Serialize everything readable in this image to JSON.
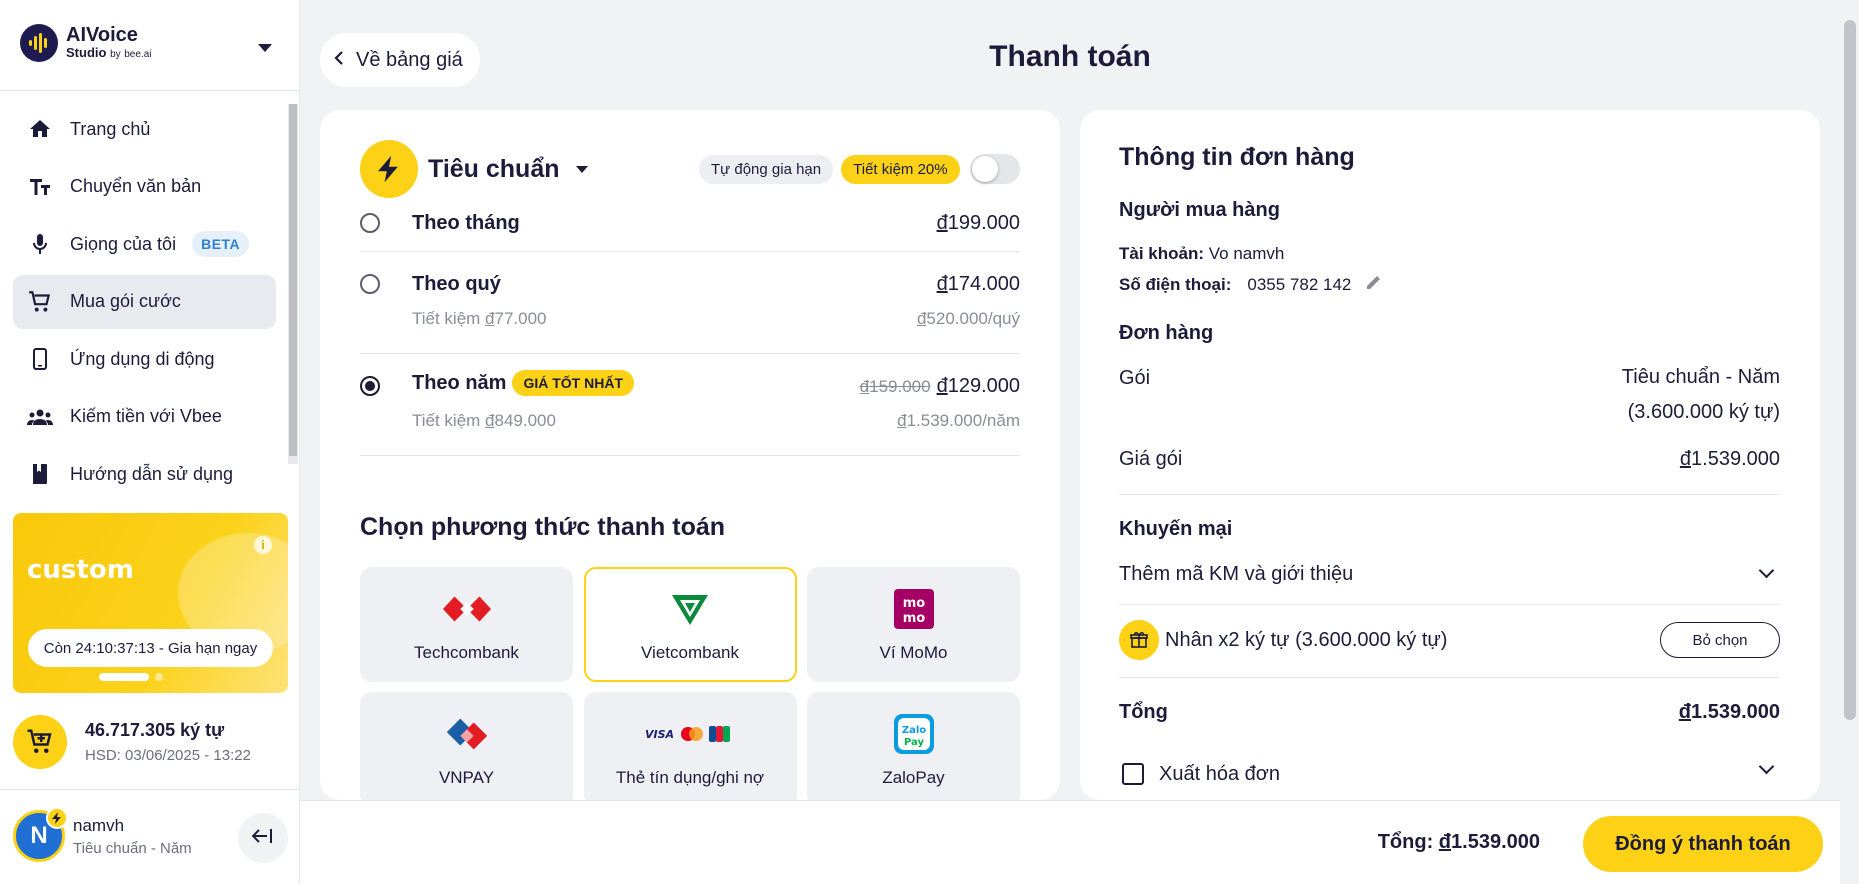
{
  "brand": {
    "name_line1": "AIVoice",
    "name_line2": "Studio",
    "by": "by",
    "partner": "bee.ai"
  },
  "sidebar": {
    "items": [
      {
        "label": "Trang chủ",
        "icon": "home-icon"
      },
      {
        "label": "Chuyển văn bản",
        "icon": "text-size-icon"
      },
      {
        "label": "Giọng của tôi",
        "icon": "microphone-icon",
        "badge": "BETA"
      },
      {
        "label": "Mua gói cước",
        "icon": "cart-icon",
        "active": true
      },
      {
        "label": "Ứng dụng di động",
        "icon": "phone-icon"
      },
      {
        "label": "Kiếm tiền với Vbee",
        "icon": "people-icon"
      },
      {
        "label": "Hướng dẫn sử dụng",
        "icon": "book-icon"
      }
    ],
    "promo": {
      "title": "custom",
      "countdown": "Còn 24:10:37:13 - Gia hạn ngay",
      "info": "i"
    },
    "credits": {
      "amount": "46.717.305 ký tự",
      "expiry": "HSD: 03/06/2025 - 13:22"
    },
    "user": {
      "initial": "N",
      "name": "namvh",
      "plan": "Tiêu chuẩn - Năm"
    }
  },
  "header": {
    "back_label": "Về bảng giá",
    "title": "Thanh toán"
  },
  "plan": {
    "name": "Tiêu chuẩn",
    "auto_renew_label": "Tự động gia hạn",
    "save_badge": "Tiết kiệm 20%",
    "auto_renew_on": false,
    "options": [
      {
        "label": "Theo tháng",
        "currency": "đ",
        "price": "199.000",
        "selected": false
      },
      {
        "label": "Theo quý",
        "currency": "đ",
        "price": "174.000",
        "save_prefix": "Tiết kiệm ",
        "save_amount": "77.000",
        "total_amount": "520.000",
        "total_suffix": "/quý",
        "selected": false
      },
      {
        "label": "Theo năm",
        "badge": "GIÁ TỐT NHẤT",
        "old_price": "159.000",
        "currency": "đ",
        "price": "129.000",
        "save_prefix": "Tiết kiệm ",
        "save_amount": "849.000",
        "total_amount": "1.539.000",
        "total_suffix": "/năm",
        "selected": true
      }
    ]
  },
  "payment": {
    "title": "Chọn phương thức thanh toán",
    "methods": [
      {
        "label": "Techcombank",
        "icon": "techcombank-logo"
      },
      {
        "label": "Vietcombank",
        "icon": "vietcombank-logo",
        "selected": true
      },
      {
        "label": "Ví MoMo",
        "icon": "momo-logo"
      },
      {
        "label": "VNPAY",
        "icon": "vnpay-logo"
      },
      {
        "label": "Thẻ tín dụng/ghi nợ",
        "icon": "card-logos"
      },
      {
        "label": "ZaloPay",
        "icon": "zalopay-logo"
      }
    ]
  },
  "order": {
    "title": "Thông tin đơn hàng",
    "buyer_heading": "Người mua hàng",
    "account_label": "Tài khoản:",
    "account_value": "Vo namvh",
    "phone_label": "Số điện thoại:",
    "phone_value": "0355 782 142",
    "order_heading": "Đơn hàng",
    "package_label": "Gói",
    "package_value_line1": "Tiêu chuẩn - Năm",
    "package_value_line2": "(3.600.000 ký tự)",
    "price_label": "Giá gói",
    "price_currency": "đ",
    "price_value": "1.539.000",
    "promo_heading": "Khuyến mại",
    "promo_code_label": "Thêm mã KM và giới thiệu",
    "promo_applied": "Nhân x2 ký tự (3.600.000 ký tự)",
    "deselect_label": "Bỏ chọn",
    "total_label": "Tổng",
    "total_currency": "đ",
    "total_value": "1.539.000",
    "invoice_label": "Xuất hóa đơn"
  },
  "footer": {
    "total_prefix": "Tổng: ",
    "total_currency": "đ",
    "total_value": "1.539.000",
    "confirm_label": "Đồng ý thanh toán"
  },
  "colors": {
    "accent": "#fcd116",
    "navy": "#1c1c3a",
    "beta_blue": "#2f80d1"
  }
}
